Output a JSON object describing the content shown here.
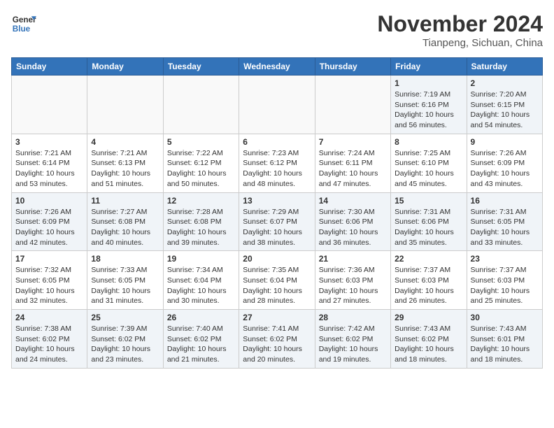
{
  "header": {
    "logo_line1": "General",
    "logo_line2": "Blue",
    "month": "November 2024",
    "location": "Tianpeng, Sichuan, China"
  },
  "days_of_week": [
    "Sunday",
    "Monday",
    "Tuesday",
    "Wednesday",
    "Thursday",
    "Friday",
    "Saturday"
  ],
  "weeks": [
    [
      {
        "day": "",
        "content": ""
      },
      {
        "day": "",
        "content": ""
      },
      {
        "day": "",
        "content": ""
      },
      {
        "day": "",
        "content": ""
      },
      {
        "day": "",
        "content": ""
      },
      {
        "day": "1",
        "content": "Sunrise: 7:19 AM\nSunset: 6:16 PM\nDaylight: 10 hours and 56 minutes."
      },
      {
        "day": "2",
        "content": "Sunrise: 7:20 AM\nSunset: 6:15 PM\nDaylight: 10 hours and 54 minutes."
      }
    ],
    [
      {
        "day": "3",
        "content": "Sunrise: 7:21 AM\nSunset: 6:14 PM\nDaylight: 10 hours and 53 minutes."
      },
      {
        "day": "4",
        "content": "Sunrise: 7:21 AM\nSunset: 6:13 PM\nDaylight: 10 hours and 51 minutes."
      },
      {
        "day": "5",
        "content": "Sunrise: 7:22 AM\nSunset: 6:12 PM\nDaylight: 10 hours and 50 minutes."
      },
      {
        "day": "6",
        "content": "Sunrise: 7:23 AM\nSunset: 6:12 PM\nDaylight: 10 hours and 48 minutes."
      },
      {
        "day": "7",
        "content": "Sunrise: 7:24 AM\nSunset: 6:11 PM\nDaylight: 10 hours and 47 minutes."
      },
      {
        "day": "8",
        "content": "Sunrise: 7:25 AM\nSunset: 6:10 PM\nDaylight: 10 hours and 45 minutes."
      },
      {
        "day": "9",
        "content": "Sunrise: 7:26 AM\nSunset: 6:09 PM\nDaylight: 10 hours and 43 minutes."
      }
    ],
    [
      {
        "day": "10",
        "content": "Sunrise: 7:26 AM\nSunset: 6:09 PM\nDaylight: 10 hours and 42 minutes."
      },
      {
        "day": "11",
        "content": "Sunrise: 7:27 AM\nSunset: 6:08 PM\nDaylight: 10 hours and 40 minutes."
      },
      {
        "day": "12",
        "content": "Sunrise: 7:28 AM\nSunset: 6:08 PM\nDaylight: 10 hours and 39 minutes."
      },
      {
        "day": "13",
        "content": "Sunrise: 7:29 AM\nSunset: 6:07 PM\nDaylight: 10 hours and 38 minutes."
      },
      {
        "day": "14",
        "content": "Sunrise: 7:30 AM\nSunset: 6:06 PM\nDaylight: 10 hours and 36 minutes."
      },
      {
        "day": "15",
        "content": "Sunrise: 7:31 AM\nSunset: 6:06 PM\nDaylight: 10 hours and 35 minutes."
      },
      {
        "day": "16",
        "content": "Sunrise: 7:31 AM\nSunset: 6:05 PM\nDaylight: 10 hours and 33 minutes."
      }
    ],
    [
      {
        "day": "17",
        "content": "Sunrise: 7:32 AM\nSunset: 6:05 PM\nDaylight: 10 hours and 32 minutes."
      },
      {
        "day": "18",
        "content": "Sunrise: 7:33 AM\nSunset: 6:05 PM\nDaylight: 10 hours and 31 minutes."
      },
      {
        "day": "19",
        "content": "Sunrise: 7:34 AM\nSunset: 6:04 PM\nDaylight: 10 hours and 30 minutes."
      },
      {
        "day": "20",
        "content": "Sunrise: 7:35 AM\nSunset: 6:04 PM\nDaylight: 10 hours and 28 minutes."
      },
      {
        "day": "21",
        "content": "Sunrise: 7:36 AM\nSunset: 6:03 PM\nDaylight: 10 hours and 27 minutes."
      },
      {
        "day": "22",
        "content": "Sunrise: 7:37 AM\nSunset: 6:03 PM\nDaylight: 10 hours and 26 minutes."
      },
      {
        "day": "23",
        "content": "Sunrise: 7:37 AM\nSunset: 6:03 PM\nDaylight: 10 hours and 25 minutes."
      }
    ],
    [
      {
        "day": "24",
        "content": "Sunrise: 7:38 AM\nSunset: 6:02 PM\nDaylight: 10 hours and 24 minutes."
      },
      {
        "day": "25",
        "content": "Sunrise: 7:39 AM\nSunset: 6:02 PM\nDaylight: 10 hours and 23 minutes."
      },
      {
        "day": "26",
        "content": "Sunrise: 7:40 AM\nSunset: 6:02 PM\nDaylight: 10 hours and 21 minutes."
      },
      {
        "day": "27",
        "content": "Sunrise: 7:41 AM\nSunset: 6:02 PM\nDaylight: 10 hours and 20 minutes."
      },
      {
        "day": "28",
        "content": "Sunrise: 7:42 AM\nSunset: 6:02 PM\nDaylight: 10 hours and 19 minutes."
      },
      {
        "day": "29",
        "content": "Sunrise: 7:43 AM\nSunset: 6:02 PM\nDaylight: 10 hours and 18 minutes."
      },
      {
        "day": "30",
        "content": "Sunrise: 7:43 AM\nSunset: 6:01 PM\nDaylight: 10 hours and 18 minutes."
      }
    ]
  ]
}
